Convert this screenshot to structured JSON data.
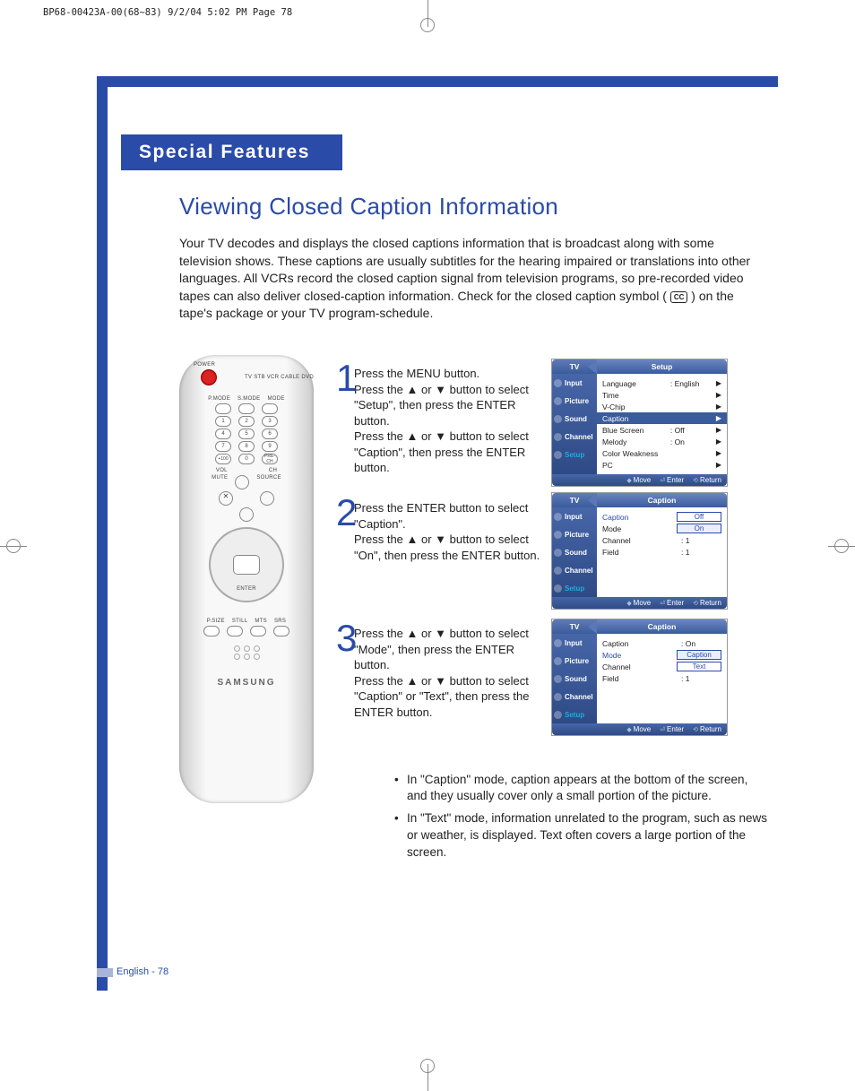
{
  "header_line": "BP68-00423A-00(68~83)  9/2/04  5:02 PM  Page 78",
  "section_title": "Special Features",
  "main_title": "Viewing Closed Caption Information",
  "intro_before_cc": "Your TV decodes and displays the closed captions information that is broadcast along with some television shows. These captions are usually subtitles for the hearing impaired or translations into other languages. All VCRs record the closed caption signal from television programs, so pre-recorded video tapes can also deliver closed-caption information. Check for the closed caption symbol (",
  "cc_badge": "CC",
  "intro_after_cc": ") on the tape's package or your TV program-schedule.",
  "remote_brand": "SAMSUNG",
  "remote_labels": {
    "power": "POWER",
    "modes": "TV  STB  VCR  CABLE  DVD",
    "pmode": "P.MODE",
    "smode": "S.MODE",
    "mode": "MODE",
    "vol": "VOL",
    "ch": "CH",
    "mute": "MUTE",
    "source": "SOURCE",
    "enter": "ENTER",
    "psize": "P.SIZE",
    "still": "STILL",
    "mts": "MTS",
    "srs": "SRS",
    "prech": "PRE-CH",
    "plus100": "+100"
  },
  "steps": {
    "s1": "Press the MENU button.\nPress the ▲ or ▼ button to select \"Setup\", then press the ENTER button.\nPress the ▲ or ▼ button to select \"Caption\", then press the ENTER button.",
    "s2": "Press the ENTER button to select \"Caption\".\nPress the ▲ or ▼ button to select \"On\", then press the ENTER button.",
    "s3": "Press the ▲ or ▼ button to select \"Mode\", then press the ENTER button.\nPress the ▲ or ▼ button to select \"Caption\" or \"Text\", then press the ENTER button."
  },
  "osd_side": {
    "input": "Input",
    "picture": "Picture",
    "sound": "Sound",
    "channel": "Channel",
    "setup": "Setup"
  },
  "osd_foot": {
    "move": "Move",
    "enter": "Enter",
    "return": "Return"
  },
  "osd1": {
    "tv": "TV",
    "title": "Setup",
    "rows": [
      {
        "k": "Language",
        "v": ": English"
      },
      {
        "k": "Time",
        "v": ""
      },
      {
        "k": "V-Chip",
        "v": ""
      },
      {
        "k": "Caption",
        "v": "",
        "hl": true
      },
      {
        "k": "Blue Screen",
        "v": ": Off"
      },
      {
        "k": "Melody",
        "v": ": On"
      },
      {
        "k": "Color Weakness",
        "v": ""
      },
      {
        "k": "PC",
        "v": ""
      }
    ]
  },
  "osd2": {
    "tv": "TV",
    "title": "Caption",
    "rows": [
      {
        "k": "Caption",
        "kblue": true,
        "v": "Off",
        "box": true
      },
      {
        "k": "Mode",
        "v": "On",
        "box": true,
        "sel": true
      },
      {
        "k": "Channel",
        "v": ": 1"
      },
      {
        "k": "Field",
        "v": ": 1"
      }
    ]
  },
  "osd3": {
    "tv": "TV",
    "title": "Caption",
    "rows": [
      {
        "k": "Caption",
        "v": ": On"
      },
      {
        "k": "Mode",
        "kblue": true,
        "v": "Caption",
        "box": true,
        "sel": true
      },
      {
        "k": "Channel",
        "v": "Text",
        "box": true
      },
      {
        "k": "Field",
        "v": ": 1"
      }
    ]
  },
  "bullets": [
    "In \"Caption\" mode, caption appears at the bottom of the screen, and they usually cover only a small portion of the picture.",
    "In \"Text\" mode, information unrelated to the program, such as news or weather, is displayed. Text often covers a large portion of the screen."
  ],
  "footer": "English - 78"
}
